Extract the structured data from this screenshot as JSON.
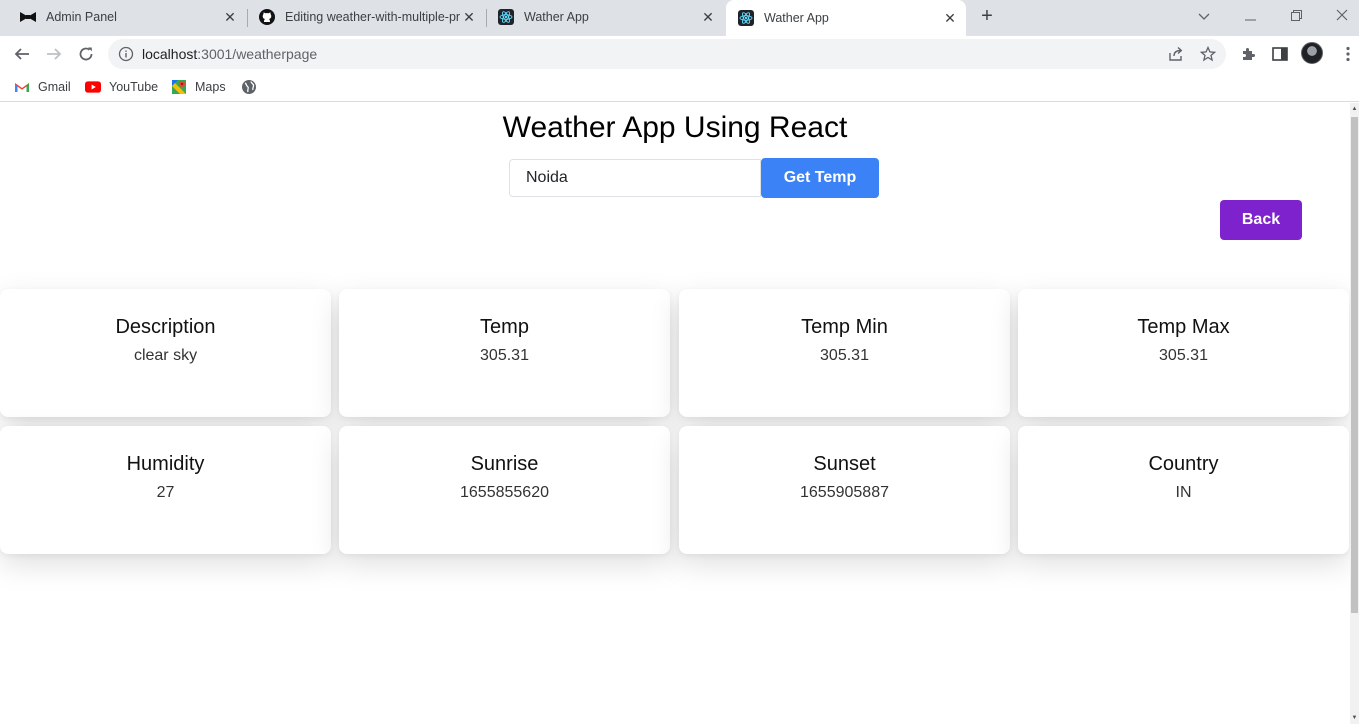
{
  "tabs": [
    {
      "title": "Admin Panel",
      "icon": "bowtie-icon"
    },
    {
      "title": "Editing weather-with-multiple-pr",
      "icon": "github-icon"
    },
    {
      "title": "Wather App",
      "icon": "react-icon"
    },
    {
      "title": "Wather App",
      "icon": "react-icon",
      "active": true
    }
  ],
  "toolbar": {
    "url_host": "localhost",
    "url_rest": ":3001/weatherpage"
  },
  "bookmarks": [
    {
      "label": "Gmail",
      "icon": "gmail-icon"
    },
    {
      "label": "YouTube",
      "icon": "youtube-icon"
    },
    {
      "label": "Maps",
      "icon": "maps-icon"
    },
    {
      "label": "",
      "icon": "globe-icon"
    }
  ],
  "page": {
    "title": "Weather App Using React",
    "search_value": "Noida",
    "get_temp_label": "Get Temp",
    "back_label": "Back",
    "colors": {
      "get_temp": "#3b82f6",
      "back": "#7e22ce"
    }
  },
  "cards": [
    {
      "label": "Description",
      "value": "clear sky"
    },
    {
      "label": "Temp",
      "value": "305.31"
    },
    {
      "label": "Temp Min",
      "value": "305.31"
    },
    {
      "label": "Temp Max",
      "value": "305.31"
    },
    {
      "label": "Humidity",
      "value": "27"
    },
    {
      "label": "Sunrise",
      "value": "1655855620"
    },
    {
      "label": "Sunset",
      "value": "1655905887"
    },
    {
      "label": "Country",
      "value": "IN"
    }
  ]
}
